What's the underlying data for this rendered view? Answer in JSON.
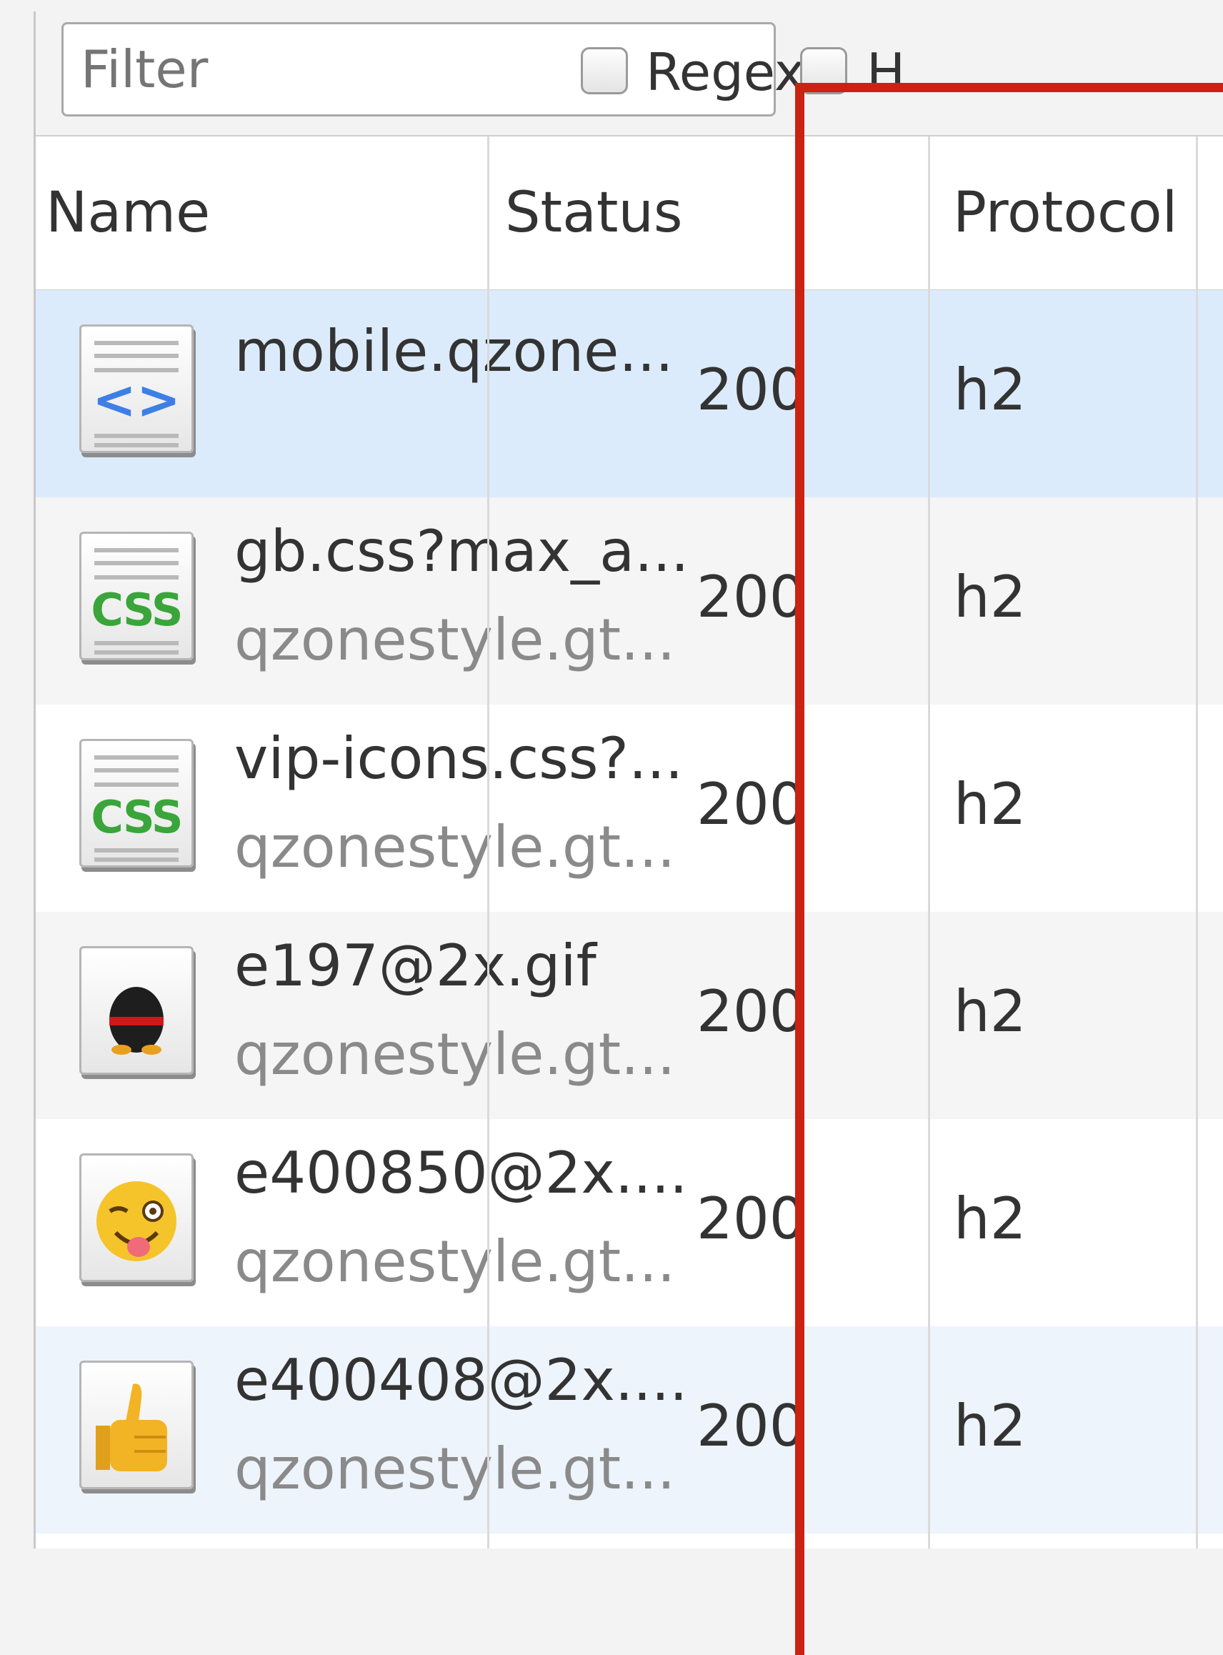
{
  "toolbar": {
    "filter_placeholder": "Filter",
    "regex_label": "Regex",
    "next_label": "H"
  },
  "columns": {
    "name": "Name",
    "status": "Status",
    "protocol": "Protocol"
  },
  "rows": [
    {
      "name": "mobile.qzone...",
      "domain": "",
      "status": "200",
      "protocol": "h2",
      "icon": "html-doc-icon",
      "selected": true
    },
    {
      "name": "gb.css?max_a...",
      "domain": "qzonestyle.gt...",
      "status": "200",
      "protocol": "h2",
      "icon": "css-doc-icon",
      "selected": false
    },
    {
      "name": "vip-icons.css?...",
      "domain": "qzonestyle.gt...",
      "status": "200",
      "protocol": "h2",
      "icon": "css-doc-icon",
      "selected": false
    },
    {
      "name": "e197@2x.gif",
      "domain": "qzonestyle.gt...",
      "status": "200",
      "protocol": "h2",
      "icon": "penguin-image-icon",
      "selected": false
    },
    {
      "name": "e400850@2x....",
      "domain": "qzonestyle.gt...",
      "status": "200",
      "protocol": "h2",
      "icon": "wink-emoji-image-icon",
      "selected": false
    },
    {
      "name": "e400408@2x....",
      "domain": "qzonestyle.gt...",
      "status": "200",
      "protocol": "h2",
      "icon": "thumbs-up-image-icon",
      "selected": false
    }
  ],
  "icon_glyphs": {
    "html": "<>",
    "css": "CSS"
  },
  "colors": {
    "selected_row": "#dcebfc",
    "alt_row": "#f5f5f5",
    "highlight_border": "#cc2211",
    "css_glyph": "#3aa53a",
    "html_glyph": "#3d7fe6"
  }
}
